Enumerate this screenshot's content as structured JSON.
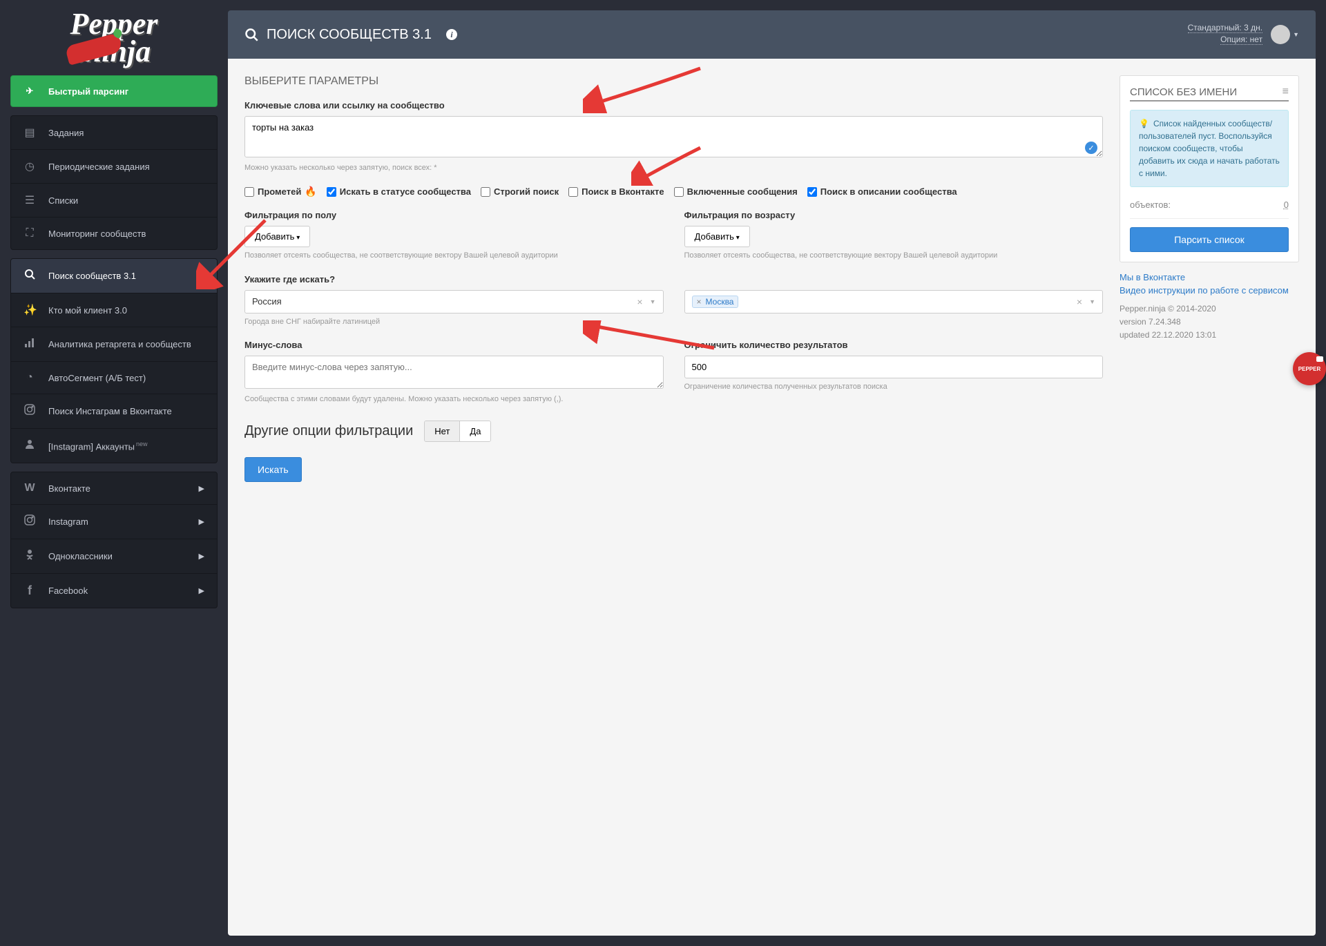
{
  "logo": "Pepper.ninja",
  "sidebar": {
    "fast": "Быстрый парсинг",
    "group1": [
      {
        "icon": "list-icon",
        "glyph": "▤",
        "label": "Задания"
      },
      {
        "icon": "clock-icon",
        "glyph": "◷",
        "label": "Периодические задания"
      },
      {
        "icon": "lists-icon",
        "glyph": "☰",
        "label": "Списки"
      },
      {
        "icon": "binoculars-icon",
        "glyph": "⛶",
        "label": "Мониторинг сообществ"
      }
    ],
    "group2": [
      {
        "icon": "search-icon",
        "glyph": "🔍",
        "label": "Поиск сообществ 3.1",
        "active": true
      },
      {
        "icon": "wand-icon",
        "glyph": "✨",
        "label": "Кто мой клиент 3.0"
      },
      {
        "icon": "chart-icon",
        "glyph": "📊",
        "label": "Аналитика ретаргета и сообществ"
      },
      {
        "icon": "pie-icon",
        "glyph": "◔",
        "label": "АвтоСегмент (А/Б тест)"
      },
      {
        "icon": "instagram-icon",
        "glyph": "◻",
        "label": "Поиск Инстаграм в Вконтакте"
      },
      {
        "icon": "user-icon",
        "glyph": "👤",
        "label": "[Instagram] Аккаунты",
        "sup": "new"
      }
    ],
    "group3": [
      {
        "icon": "vk-icon",
        "glyph": "W",
        "label": "Вконтакте"
      },
      {
        "icon": "instagram-icon",
        "glyph": "◻",
        "label": "Instagram"
      },
      {
        "icon": "ok-icon",
        "glyph": "ȯ",
        "label": "Одноклассники"
      },
      {
        "icon": "fb-icon",
        "glyph": "f",
        "label": "Facebook"
      }
    ]
  },
  "header": {
    "title": "ПОИСК СООБЩЕСТВ 3.1",
    "plan": "Стандартный: 3 дн.",
    "option": "Опция: нет"
  },
  "form": {
    "section_title": "ВЫБЕРИТЕ ПАРАМЕТРЫ",
    "keywords_label": "Ключевые слова или ссылку на сообщество",
    "keywords_value": "торты на заказ",
    "keywords_hint": "Можно указать несколько через запятую, поиск всех: *",
    "checks": {
      "c1": "Прометей",
      "c2": "Искать в статусе сообщества",
      "c3": "Строгий поиск",
      "c4": "Поиск в Вконтакте",
      "c5": "Включенные сообщения",
      "c6": "Поиск в описании сообщества"
    },
    "filter_gender_label": "Фильтрация по полу",
    "filter_gender_btn": "Добавить",
    "filter_gender_hint": "Позволяет отсеять сообщества, не соответствующие вектору Вашей целевой аудитории",
    "filter_age_label": "Фильтрация по возрасту",
    "filter_age_btn": "Добавить",
    "filter_age_hint": "Позволяет отсеять сообщества, не соответствующие вектору Вашей целевой аудитории",
    "where_label": "Укажите где искать?",
    "country_value": "Россия",
    "city_value": "Москва",
    "where_hint": "Города вне СНГ набирайте латиницей",
    "minus_label": "Минус-слова",
    "minus_placeholder": "Введите минус-слова через запятую...",
    "minus_hint": "Сообщества с этими словами будут удалены. Можно указать несколько через запятую (,).",
    "limit_label": "Ограничить количество результатов",
    "limit_value": "500",
    "limit_hint": "Ограничение количества полученных результатов поиска",
    "other_label": "Другие опции фильтрации",
    "other_no": "Нет",
    "other_yes": "Да",
    "submit": "Искать"
  },
  "panel": {
    "title": "СПИСОК БЕЗ ИМЕНИ",
    "info": "Список найденных сообществ/пользователей пуст. Воспользуйся поиском сообществ, чтобы добавить их сюда и начать работать с ними.",
    "objects_label": "объектов:",
    "objects_count": "0",
    "parse_btn": "Парсить список",
    "link_vk": "Мы в Вконтакте",
    "link_video": "Видео инструкции по работе с сервисом",
    "copyright": "Pepper.ninja © 2014-2020",
    "version": "version 7.24.348",
    "updated": "updated 22.12.2020 13:01"
  },
  "badge": "PEPPER"
}
